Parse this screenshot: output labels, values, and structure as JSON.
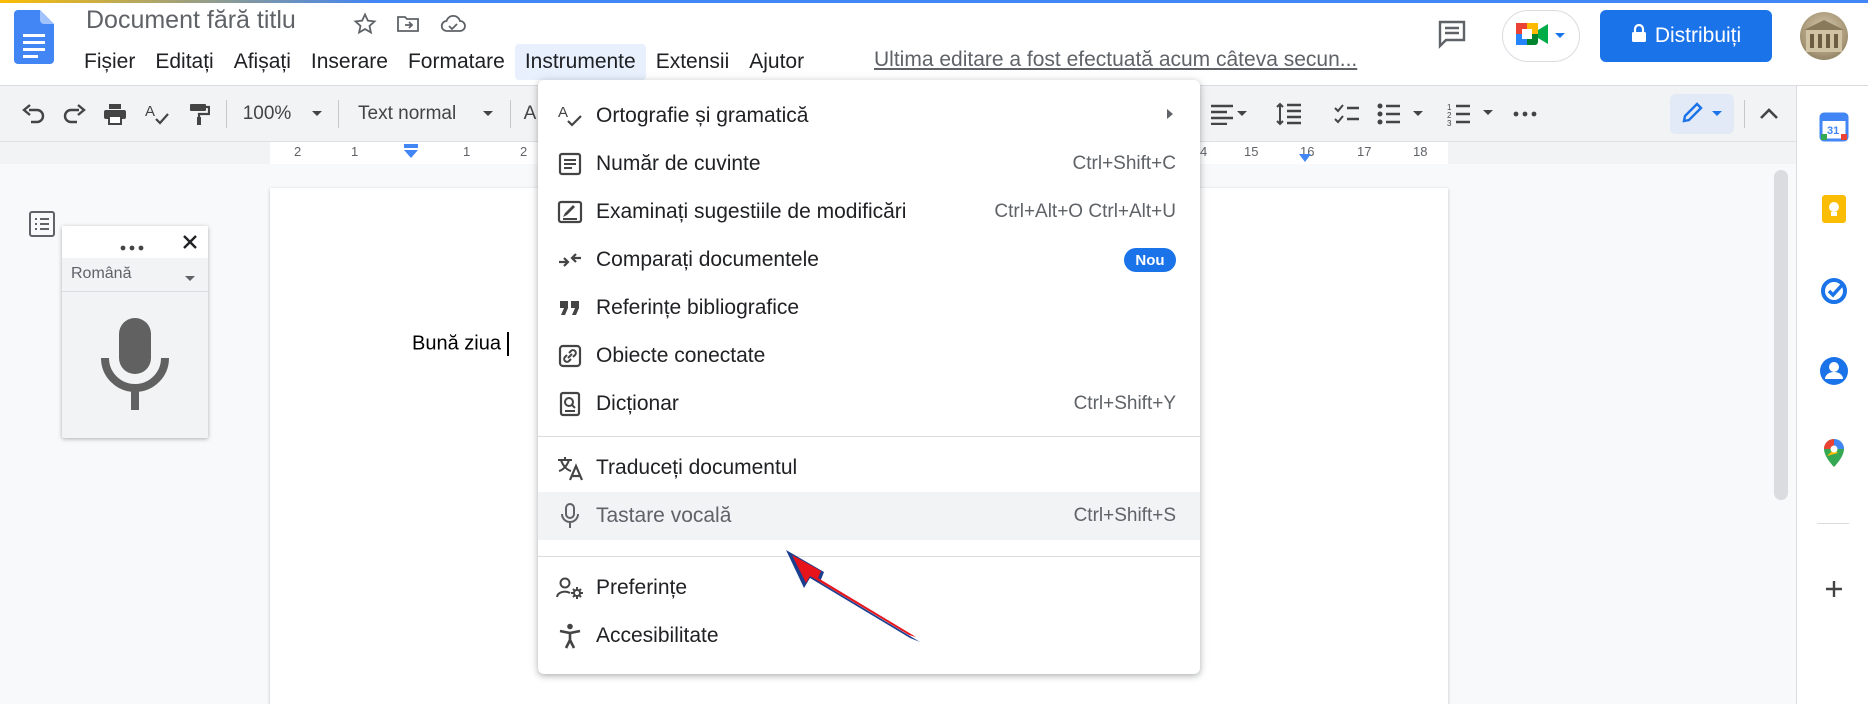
{
  "app": {
    "doc_title": "Document fără titlu",
    "last_edit": "Ultima editare a fost efectuată acum câteva secun...",
    "share_label": "Distribuiți",
    "brand_color": "#1a73e8"
  },
  "menubar": {
    "items": [
      "Fișier",
      "Editați",
      "Afișați",
      "Inserare",
      "Formatare",
      "Instrumente",
      "Extensii",
      "Ajutor"
    ],
    "active": "Instrumente"
  },
  "toolbar": {
    "zoom": "100%",
    "style": "Text normal",
    "font_partial": "A"
  },
  "ruler": {
    "ticks": [
      "2",
      "1",
      "1",
      "2",
      "4",
      "15",
      "16",
      "17",
      "18"
    ]
  },
  "document": {
    "text": "Bună ziua"
  },
  "voice_panel": {
    "language": "Română",
    "icon": "microphone-icon"
  },
  "tools_menu": {
    "items": [
      {
        "label": "Ortografie și gramatică",
        "icon": "spellcheck-icon",
        "shortcut": "",
        "submenu": true
      },
      {
        "label": "Număr de cuvinte",
        "icon": "word-count-icon",
        "shortcut": "Ctrl+Shift+C"
      },
      {
        "label": "Examinați sugestiile de modificări",
        "icon": "review-suggestions-icon",
        "shortcut": "Ctrl+Alt+O Ctrl+Alt+U"
      },
      {
        "label": "Comparați documentele",
        "icon": "compare-icon",
        "shortcut": "",
        "badge": "Nou"
      },
      {
        "label": "Referințe bibliografice",
        "icon": "quote-icon",
        "shortcut": ""
      },
      {
        "label": "Obiecte conectate",
        "icon": "linked-objects-icon",
        "shortcut": ""
      },
      {
        "label": "Dicționar",
        "icon": "dictionary-icon",
        "shortcut": "Ctrl+Shift+Y"
      },
      {
        "label": "Traduceți documentul",
        "icon": "translate-icon",
        "shortcut": ""
      },
      {
        "label": "Tastare vocală",
        "icon": "microphone-icon",
        "shortcut": "Ctrl+Shift+S",
        "highlighted": true
      },
      {
        "label": "Preferințe",
        "icon": "preferences-icon",
        "shortcut": ""
      },
      {
        "label": "Accesibilitate",
        "icon": "accessibility-icon",
        "shortcut": ""
      }
    ]
  },
  "annotation": {
    "arrow_color": "#e8141c",
    "arrow_outline": "#1a3f8f"
  }
}
